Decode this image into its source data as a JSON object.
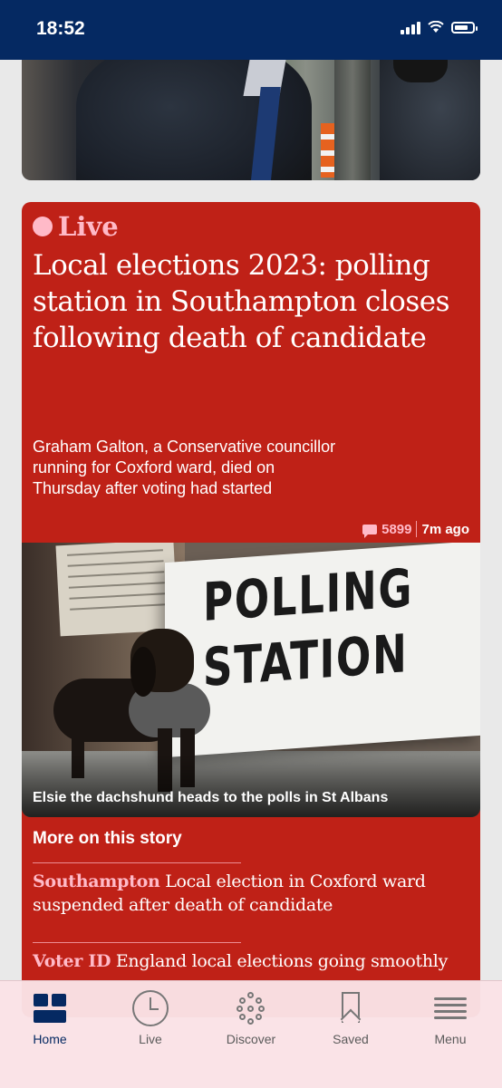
{
  "status_bar": {
    "time": "18:52"
  },
  "live_card": {
    "live_label": "Live",
    "headline": "Local elections 2023: polling station in Southampton closes following death of candidate",
    "standfirst": "Graham Galton, a Conservative councillor running for Coxford ward, died on Thursday after voting had started",
    "comment_count": "5899",
    "time_ago": "7m ago",
    "image_sign_text": "POLLING STATION",
    "image_caption": "Elsie the dachshund heads to the polls in St Albans",
    "more_title": "More on this story",
    "related": [
      {
        "kicker": "Southampton",
        "text": " Local election in Coxford ward suspended after death of candidate"
      },
      {
        "kicker": "Voter ID",
        "text": " England local elections going smoothly"
      }
    ]
  },
  "tab_bar": {
    "tabs": [
      {
        "label": "Home",
        "icon": "home-icon",
        "active": true
      },
      {
        "label": "Live",
        "icon": "clock-icon"
      },
      {
        "label": "Discover",
        "icon": "discover-icon"
      },
      {
        "label": "Saved",
        "icon": "bookmark-icon"
      },
      {
        "label": "Menu",
        "icon": "menu-icon"
      }
    ]
  },
  "colors": {
    "header_blue": "#052962",
    "live_red": "#bf2117",
    "live_pink": "#ffbac8",
    "tab_bar_bg": "#fae2e6"
  }
}
